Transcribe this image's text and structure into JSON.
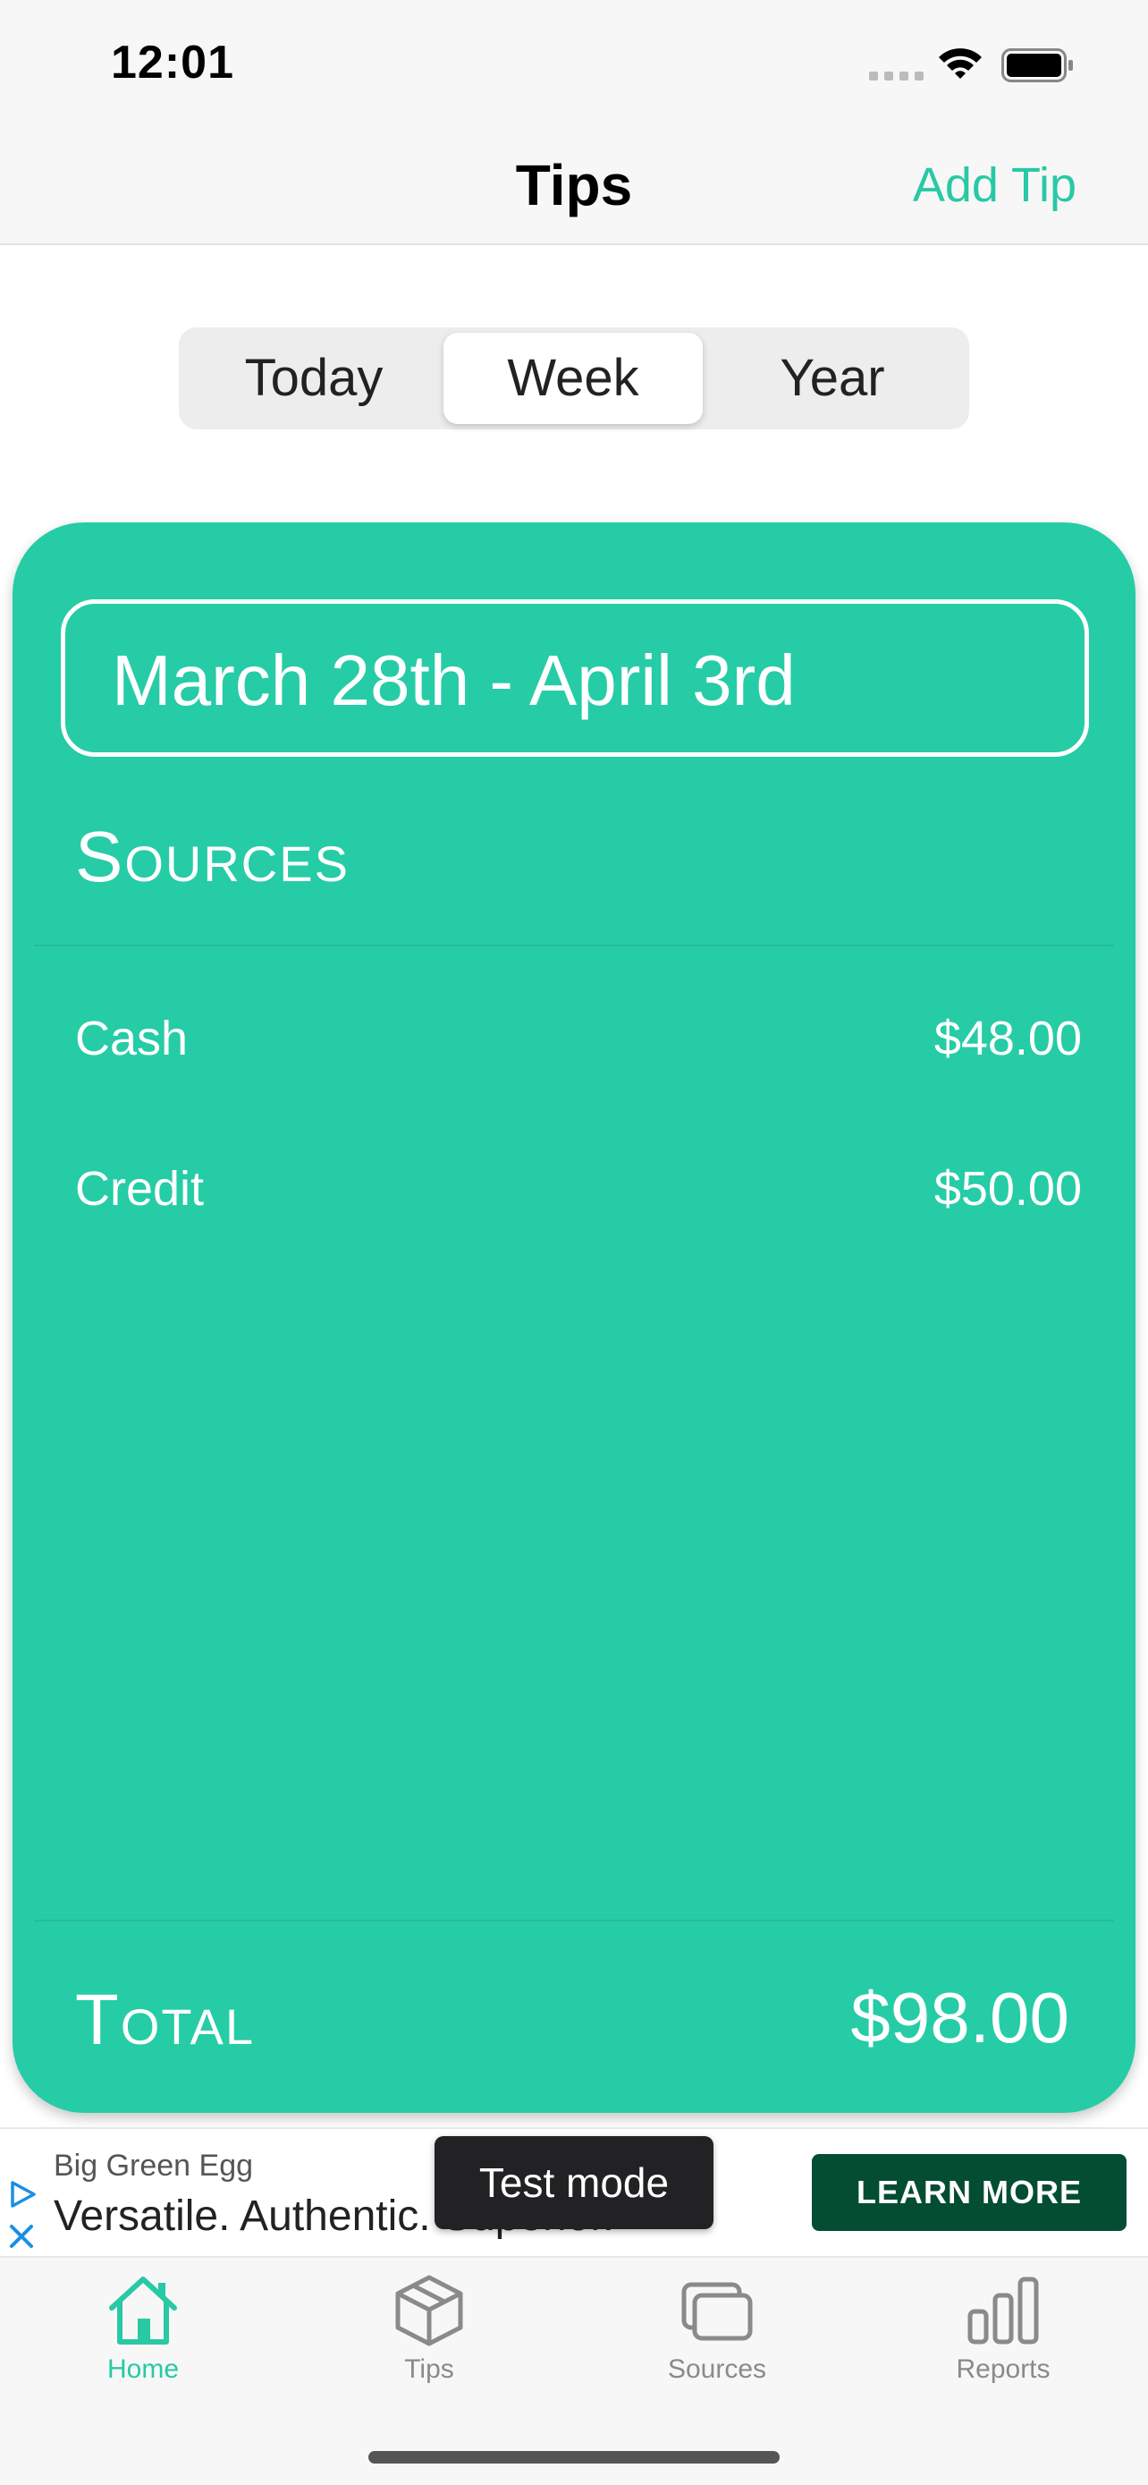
{
  "status_bar": {
    "time": "12:01"
  },
  "nav": {
    "title": "Tips",
    "action": "Add Tip"
  },
  "segments": [
    "Today",
    "Week",
    "Year"
  ],
  "selected_segment": "Week",
  "card": {
    "date_range": "March 28th - April 3rd",
    "sources_title": "Sources",
    "sources": [
      {
        "name": "Cash",
        "amount": "$48.00"
      },
      {
        "name": "Credit",
        "amount": "$50.00"
      }
    ],
    "total_label": "Total",
    "total_amount": "$98.00"
  },
  "ad": {
    "advertiser": "Big Green Egg",
    "headline": "Versatile. Authentic. Superior.",
    "test_mode": "Test mode",
    "cta": "LEARN MORE"
  },
  "tabs": [
    {
      "label": "Home",
      "icon": "home-icon",
      "active": true
    },
    {
      "label": "Tips",
      "icon": "box-icon",
      "active": false
    },
    {
      "label": "Sources",
      "icon": "cards-icon",
      "active": false
    },
    {
      "label": "Reports",
      "icon": "bar-chart-icon",
      "active": false
    }
  ],
  "colors": {
    "accent": "#26cca6",
    "cta": "#034d32",
    "inactive": "#8a8a8a"
  }
}
